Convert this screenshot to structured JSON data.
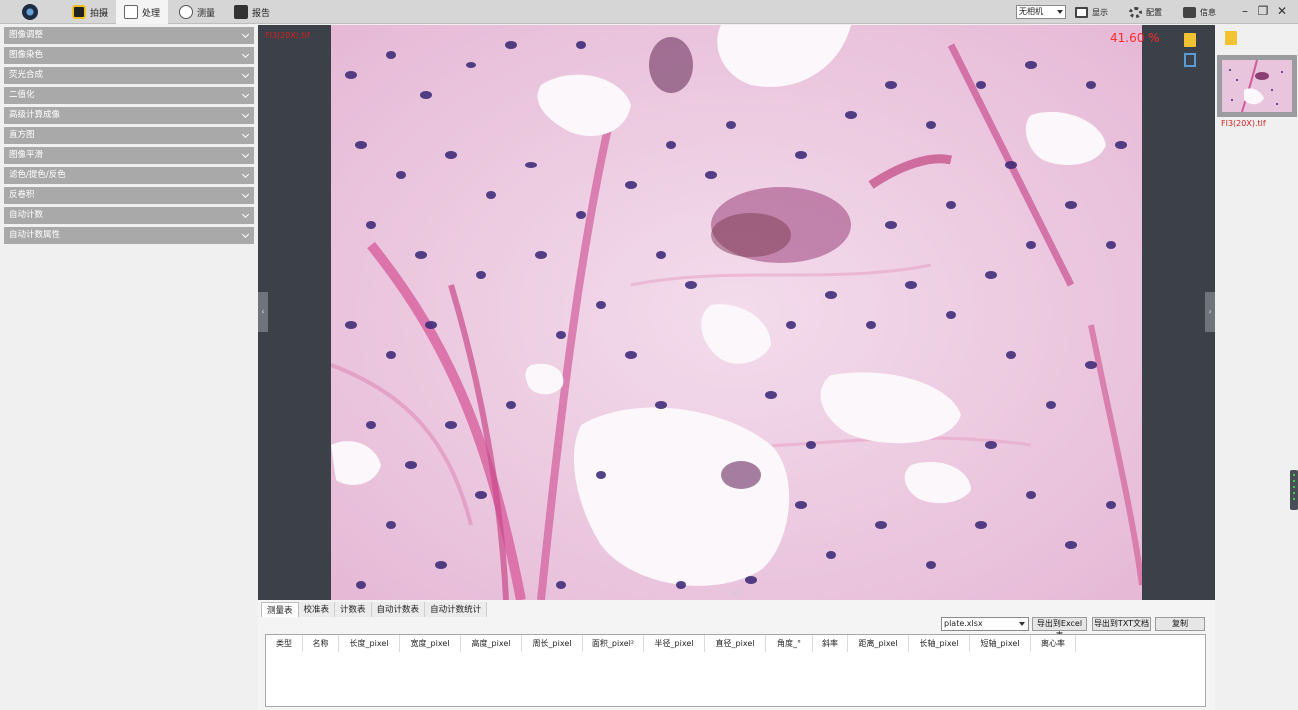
{
  "topbar": {
    "tabs": [
      {
        "label": "拍摄",
        "icon": "camera-capture-icon"
      },
      {
        "label": "处理",
        "icon": "image-process-icon"
      },
      {
        "label": "测量",
        "icon": "measure-icon"
      },
      {
        "label": "报告",
        "icon": "report-icon"
      }
    ],
    "camera_select": "无相机",
    "tools": [
      {
        "label": "显示",
        "icon": "display-icon"
      },
      {
        "label": "配置",
        "icon": "gear-icon"
      },
      {
        "label": "信息",
        "icon": "info-icon"
      }
    ],
    "window": {
      "minimize": "–",
      "restore": "❐",
      "close": "✕"
    }
  },
  "sidebar": {
    "items": [
      {
        "label": "图像调整"
      },
      {
        "label": "图像染色"
      },
      {
        "label": "荧光合成"
      },
      {
        "label": "二值化"
      },
      {
        "label": "高级计算成像"
      },
      {
        "label": "直方图"
      },
      {
        "label": "图像平滑"
      },
      {
        "label": "滤色/提色/反色"
      },
      {
        "label": "反卷积"
      },
      {
        "label": "自动计数"
      },
      {
        "label": "自动计数属性"
      }
    ]
  },
  "viewer": {
    "filename": "FI3(20X).tif",
    "zoom": "41.60 %",
    "left_toggle": "‹",
    "right_toggle": "›"
  },
  "thumbnails": [
    {
      "label": "FI3(20X).tif"
    }
  ],
  "bottom": {
    "tabs": [
      {
        "label": "测量表"
      },
      {
        "label": "校准表"
      },
      {
        "label": "计数表"
      },
      {
        "label": "自动计数表"
      },
      {
        "label": "自动计数统计"
      }
    ],
    "file_select": "plate.xlsx",
    "buttons": {
      "export_excel": "导出到Excel表",
      "export_txt": "导出到TXT文档",
      "copy": "复制"
    },
    "columns": [
      "类型",
      "名称",
      "长度_pixel",
      "宽度_pixel",
      "高度_pixel",
      "周长_pixel",
      "面积_pixel²",
      "半径_pixel",
      "直径_pixel",
      "角度_°",
      "斜率",
      "距离_pixel",
      "长轴_pixel",
      "短轴_pixel",
      "离心率"
    ]
  },
  "colors": {
    "accent_red": "#ff2a2a",
    "sidebar_header": "#a9a9a9",
    "viewer_bg": "#3c4049"
  }
}
